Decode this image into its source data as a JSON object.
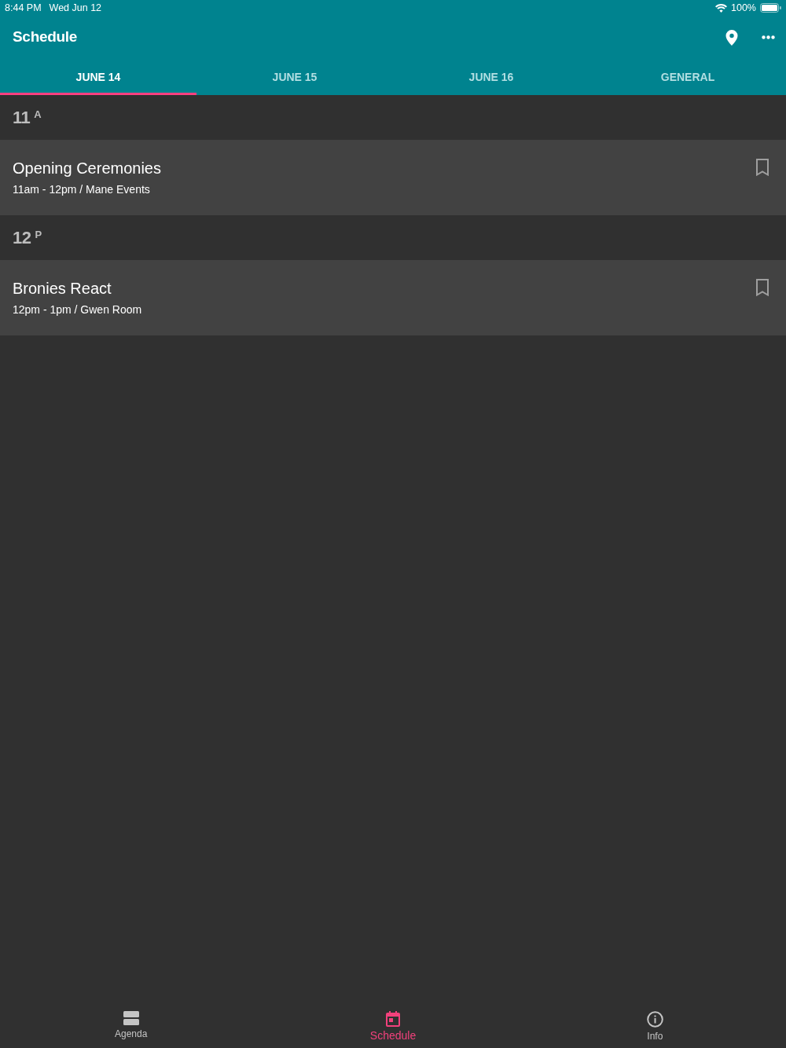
{
  "status_bar": {
    "time": "8:44 PM",
    "date": "Wed Jun 12",
    "battery": "100%"
  },
  "app_bar": {
    "title": "Schedule"
  },
  "tabs": [
    {
      "label": "JUNE 14",
      "selected": true
    },
    {
      "label": "JUNE 15",
      "selected": false
    },
    {
      "label": "JUNE 16",
      "selected": false
    },
    {
      "label": "GENERAL",
      "selected": false
    }
  ],
  "sections": [
    {
      "hour": "11",
      "meridiem": "A",
      "events": [
        {
          "title": "Opening Ceremonies",
          "details": "11am - 12pm / Mane Events",
          "bookmarked": false
        }
      ]
    },
    {
      "hour": "12",
      "meridiem": "P",
      "events": [
        {
          "title": "Bronies React",
          "details": "12pm - 1pm / Gwen Room",
          "bookmarked": false
        }
      ]
    }
  ],
  "bottom_nav": [
    {
      "label": "Agenda",
      "kind": "agenda",
      "selected": false
    },
    {
      "label": "Schedule",
      "kind": "schedule",
      "selected": true
    },
    {
      "label": "Info",
      "kind": "info",
      "selected": false
    }
  ]
}
